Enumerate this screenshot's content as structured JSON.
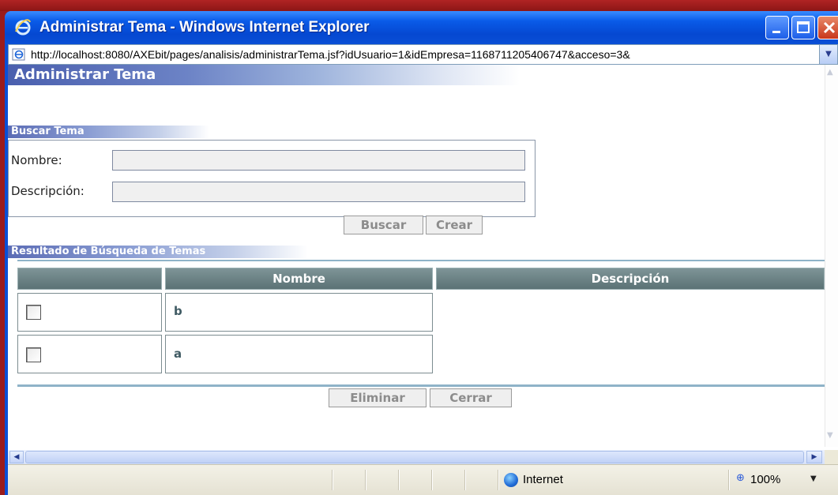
{
  "window": {
    "title": "Administrar Tema - Windows Internet Explorer",
    "address": "http://localhost:8080/AXEbit/pages/analisis/administrarTema.jsf?idUsuario=1&idEmpresa=1168711205406747&acceso=3&"
  },
  "page": {
    "title": "Administrar Tema",
    "search_section": {
      "title": "Buscar Tema",
      "nombre_label": "Nombre:",
      "nombre_value": "",
      "descripcion_label": "Descripción:",
      "descripcion_value": "",
      "buscar_label": "Buscar",
      "crear_label": "Crear"
    },
    "results_section": {
      "title": "Resultado de Búsqueda de Temas",
      "columns": [
        "",
        "Nombre",
        "Descripción"
      ],
      "rows": [
        {
          "checked": false,
          "nombre": "b",
          "descripcion": ""
        },
        {
          "checked": false,
          "nombre": "a",
          "descripcion": ""
        }
      ],
      "eliminar_label": "Eliminar",
      "cerrar_label": "Cerrar"
    }
  },
  "statusbar": {
    "zone": "Internet",
    "zoom": "100%"
  },
  "colors": {
    "titlebar": "#0a4fd6",
    "header_gradient_start": "#4a5fae",
    "table_header": "#6b8285",
    "cell_text": "#3f5a63"
  }
}
